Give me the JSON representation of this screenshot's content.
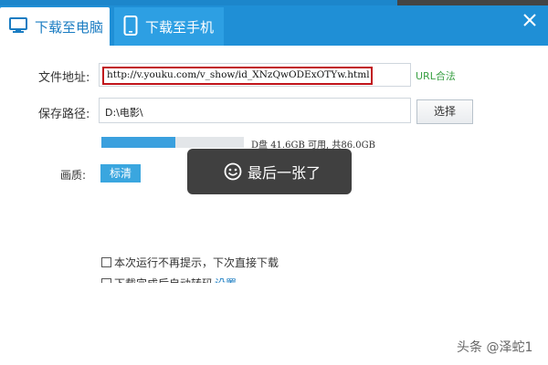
{
  "tabs": [
    {
      "label": "下载至电脑",
      "icon": "monitor-icon",
      "active": true
    },
    {
      "label": "下载至手机",
      "icon": "phone-icon",
      "active": false
    }
  ],
  "form": {
    "url_label": "文件地址:",
    "url_value": "http://v.youku.com/v_show/id_XNzQwODExOTYw.html",
    "url_status": "URL合法",
    "path_label": "保存路径:",
    "path_value": "D:\\电影\\",
    "choose_button": "选择",
    "disk_used_fraction": 0.52,
    "disk_info": "D盘 41.6GB 可用, 共86.0GB",
    "quality_label": "画质:",
    "quality_value": "标清"
  },
  "toast": {
    "text": "最后一张了",
    "icon": "smile-icon"
  },
  "options": {
    "no_prompt": "本次运行不再提示，下次直接下载",
    "auto_transcode": "下载完成后自动转码",
    "settings_link": "设置"
  },
  "watermark": "头条 @泽蛇1",
  "colors": {
    "header_blue": "#1f8fd6",
    "accent_blue": "#3aa0de",
    "highlight_red": "#c0141b",
    "valid_green": "#3aa044",
    "toast_bg": "#303030"
  }
}
